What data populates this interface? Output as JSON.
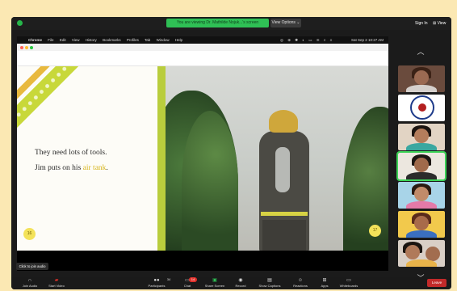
{
  "zoom": {
    "share_banner": "You are viewing Dr. Mathilde Nojuk...'s screen",
    "view_options": "View Options ⌄",
    "sign_in": "Sign In",
    "view": "⊞ View",
    "join_audio_tip": "Click to join audio"
  },
  "mac_menubar": {
    "apple": "",
    "items": [
      "Chrome",
      "File",
      "Edit",
      "View",
      "History",
      "Bookmarks",
      "Profiles",
      "Tab",
      "Window",
      "Help"
    ],
    "clock": "Sat Sep 2  10:27 AM"
  },
  "book": {
    "line1": "They need lots of tools.",
    "line2_prefix": "Jim puts on his ",
    "line2_highlight": "air tank",
    "line2_suffix": ".",
    "page_left": "16",
    "page_right": "17",
    "accent_green": "#b9cd3d",
    "accent_yellow": "#f3e25a"
  },
  "gallery": {
    "up": "︿",
    "down": "﹀"
  },
  "toolbar": {
    "join_audio": "Join Audio",
    "start_video": "Start Video",
    "participants": "Participants",
    "participants_count": "34",
    "chat": "Chat",
    "chat_badge": "14",
    "share_screen": "Share Screen",
    "record": "Record",
    "show_captions": "Show Captions",
    "reactions": "Reactions",
    "apps": "Apps",
    "whiteboards": "Whiteboards",
    "leave": "Leave"
  }
}
